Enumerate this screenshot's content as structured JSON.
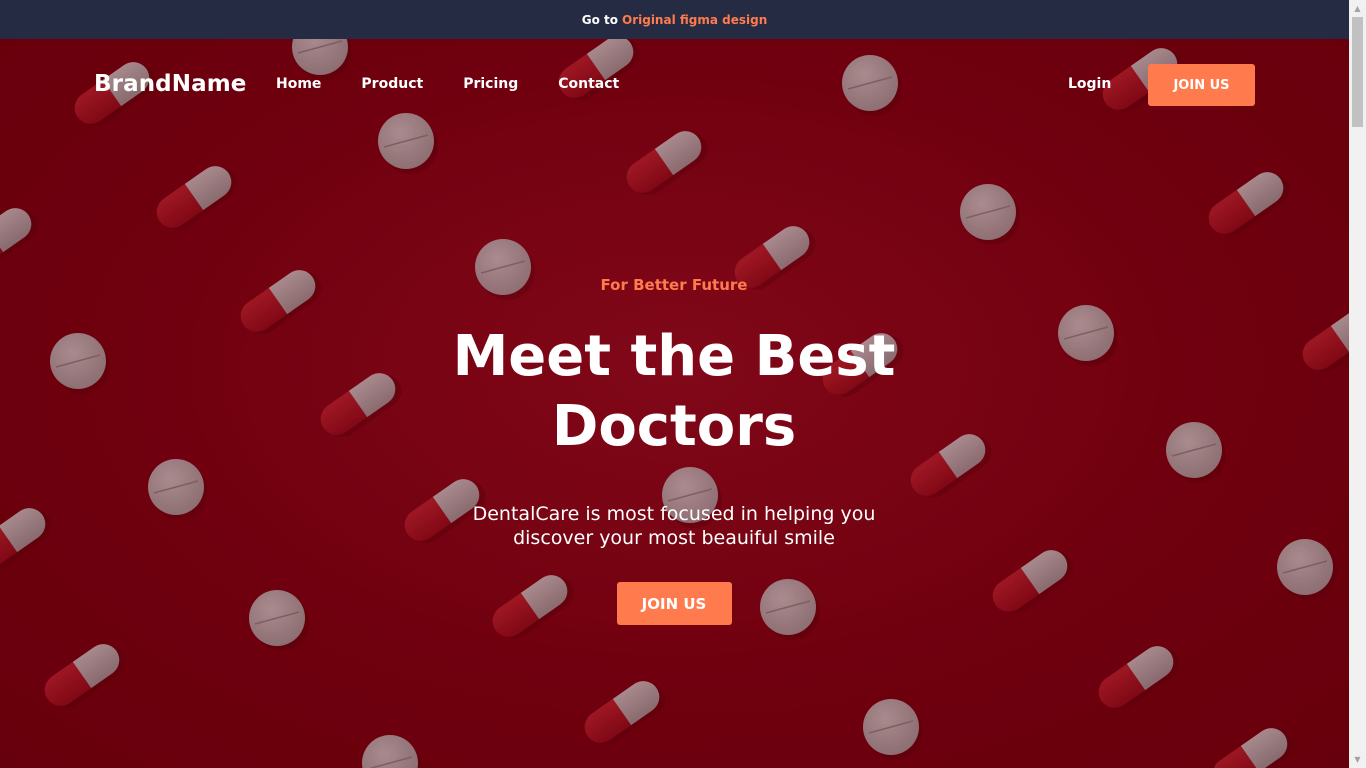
{
  "announcement": {
    "prefix": "Go to",
    "link_label": "Original figma design",
    "link_color": "#ff7b4e",
    "background": "#252b42"
  },
  "nav": {
    "brand": "BrandName",
    "items": [
      {
        "label": "Home"
      },
      {
        "label": "Product"
      },
      {
        "label": "Pricing"
      },
      {
        "label": "Contact"
      }
    ],
    "login_label": "Login",
    "join_label": "JOIN US"
  },
  "hero": {
    "eyebrow": "For Better Future",
    "headline_line1": "Meet the Best",
    "headline_line2": "Doctors",
    "subtitle_line1": "DentalCare is most focused in helping you",
    "subtitle_line2": "discover your most beauiful smile",
    "cta_label": "JOIN US",
    "accent_color": "#ff7b4e",
    "background_color": "#74000f"
  },
  "icons": {
    "scroll_up": "triangle-up-icon",
    "scroll_down": "triangle-down-icon"
  }
}
